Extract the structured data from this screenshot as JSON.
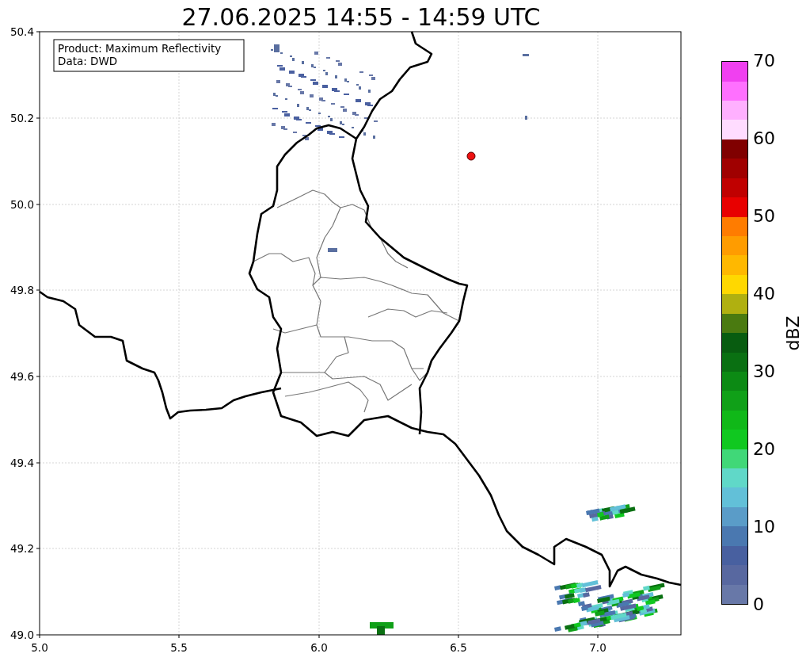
{
  "title": "27.06.2025 14:55 - 14:59 UTC",
  "info_box": [
    "Product: Maximum Reflectivity",
    "Data: DWD"
  ],
  "x_axis": {
    "ticks": [
      "5.0",
      "5.5",
      "6.0",
      "6.5",
      "7.0"
    ]
  },
  "y_axis": {
    "ticks": [
      "50.4",
      "50.2",
      "50.0",
      "49.8",
      "49.6",
      "49.4",
      "49.2",
      "49.0"
    ]
  },
  "colorbar": {
    "label": "dBZ",
    "ticks": [
      "70",
      "60",
      "50",
      "40",
      "30",
      "20",
      "10",
      "0"
    ],
    "segments": [
      {
        "color": "#6878a8"
      },
      {
        "color": "#5868a0"
      },
      {
        "color": "#4860a0"
      },
      {
        "color": "#4a78b0"
      },
      {
        "color": "#5a9cc8"
      },
      {
        "color": "#62c0d8"
      },
      {
        "color": "#60d8c8"
      },
      {
        "color": "#40d878"
      },
      {
        "color": "#10c820"
      },
      {
        "color": "#10b818"
      },
      {
        "color": "#10a018"
      },
      {
        "color": "#0c8a14"
      },
      {
        "color": "#0a7012"
      },
      {
        "color": "#085c10"
      },
      {
        "color": "#4a7a10"
      },
      {
        "color": "#b0b010"
      },
      {
        "color": "#ffd800"
      },
      {
        "color": "#ffb800"
      },
      {
        "color": "#ff9c00"
      },
      {
        "color": "#ff7c00"
      },
      {
        "color": "#e80000"
      },
      {
        "color": "#c00000"
      },
      {
        "color": "#a00000"
      },
      {
        "color": "#800000"
      },
      {
        "color": "#ffdcff"
      },
      {
        "color": "#ffb0ff"
      },
      {
        "color": "#ff70ff"
      },
      {
        "color": "#f040f0"
      }
    ]
  }
}
